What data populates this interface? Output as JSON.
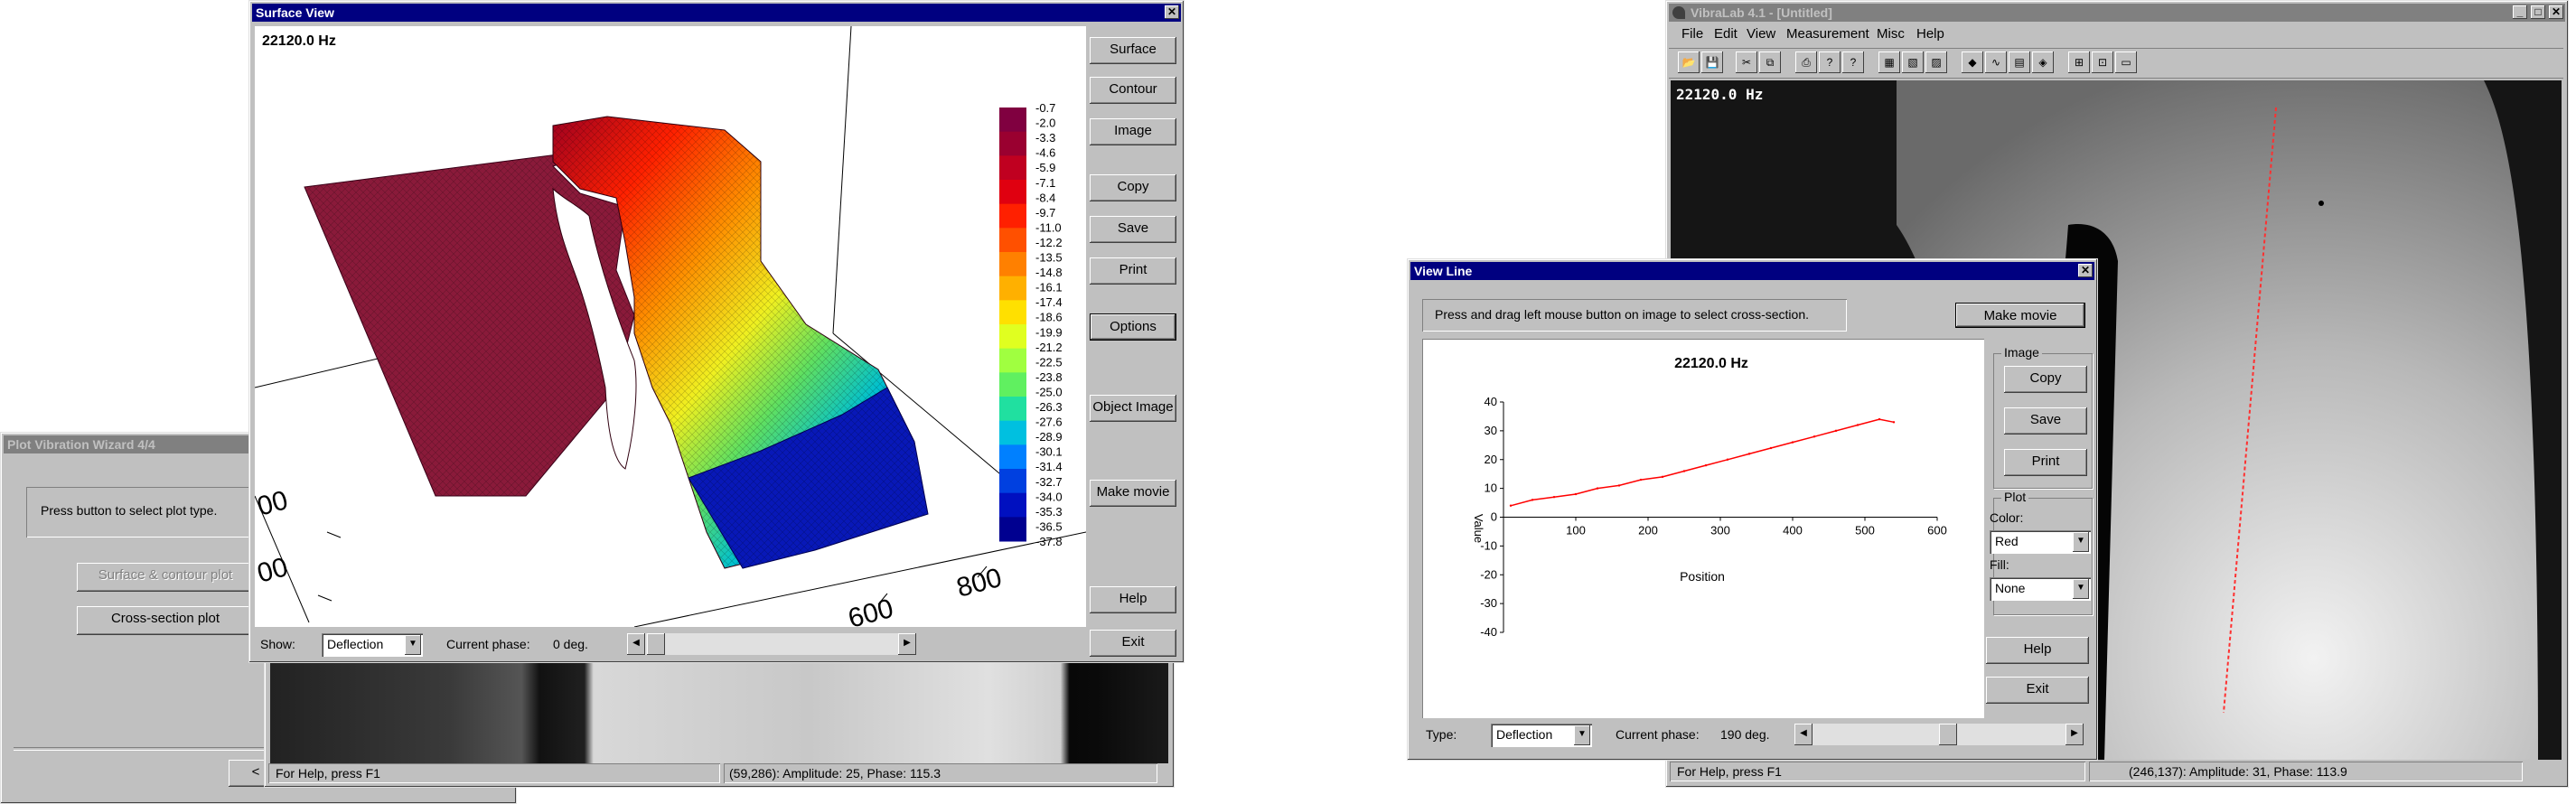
{
  "wizard": {
    "title": "Plot Vibration Wizard 4/4",
    "instruction": "Press button to select plot type.",
    "surface_btn": "Surface & contour plot",
    "cross_btn": "Cross-section plot",
    "back_btn": "<"
  },
  "mid_app": {
    "status_help": "For Help, press F1",
    "status_coords": "(59,286): Amplitude: 25, Phase: 115.3"
  },
  "surface": {
    "title": "Surface View",
    "freq": "22120.0 Hz",
    "buttons": [
      "Surface",
      "Contour",
      "Image",
      "Copy",
      "Save",
      "Print",
      "Options",
      "Object Image",
      "Make movie",
      "Help",
      "Exit"
    ],
    "show_label": "Show:",
    "show_value": "Deflection",
    "phase_label": "Current phase:",
    "phase_value": "0 deg.",
    "axis_labels": [
      "00",
      "00",
      "600",
      "800"
    ],
    "colorbar": [
      "-0.7",
      "-2.0",
      "-3.3",
      "-4.6",
      "-5.9",
      "-7.1",
      "-8.4",
      "-9.7",
      "-11.0",
      "-12.2",
      "-13.5",
      "-14.8",
      "-16.1",
      "-17.4",
      "-18.6",
      "-19.9",
      "-21.2",
      "-22.5",
      "-23.8",
      "-25.0",
      "-26.3",
      "-27.6",
      "-28.9",
      "-30.1",
      "-31.4",
      "-32.7",
      "-34.0",
      "-35.3",
      "-36.5",
      "-37.8"
    ],
    "colorbar_colors": [
      "#800040",
      "#9a0030",
      "#c00020",
      "#e00010",
      "#ff2000",
      "#ff5000",
      "#ff8000",
      "#ffb000",
      "#ffe000",
      "#e0ff20",
      "#a0ff40",
      "#60f060",
      "#20e0a0",
      "#00c0e0",
      "#0080ff",
      "#0040e0",
      "#0010c0",
      "#000090"
    ]
  },
  "vibralab": {
    "title": "VibraLab 4.1 - [Untitled]",
    "menu": [
      "File",
      "Edit",
      "View",
      "Measurement",
      "Misc",
      "Help"
    ],
    "freq_overlay": "22120.0 Hz",
    "status_help": "For Help, press F1",
    "status_coords": "(246,137): Amplitude: 31, Phase: 113.9"
  },
  "viewline": {
    "title": "View Line",
    "instruction": "Press and drag left mouse button on image to select cross-section.",
    "make_movie": "Make movie",
    "image_group": "Image",
    "copy": "Copy",
    "save": "Save",
    "print": "Print",
    "plot_group": "Plot",
    "color_label": "Color:",
    "color_value": "Red",
    "fill_label": "Fill:",
    "fill_value": "None",
    "help": "Help",
    "exit": "Exit",
    "type_label": "Type:",
    "type_value": "Deflection",
    "phase_label": "Current phase:",
    "phase_value": "190 deg."
  },
  "chart_data": {
    "type": "line",
    "title": "22120.0 Hz",
    "xlabel": "Position",
    "ylabel": "Value",
    "xlim": [
      0,
      600
    ],
    "ylim": [
      -40,
      40
    ],
    "xticks": [
      100,
      200,
      300,
      400,
      500,
      600
    ],
    "yticks": [
      40,
      30,
      20,
      10,
      0,
      -10,
      -20,
      -30,
      -40
    ],
    "series": [
      {
        "color": "#ff0000",
        "x": [
          10,
          40,
          70,
          100,
          130,
          160,
          190,
          220,
          250,
          280,
          310,
          340,
          370,
          400,
          430,
          460,
          490,
          520,
          540
        ],
        "y": [
          4,
          6,
          7,
          8,
          10,
          11,
          13,
          14,
          16,
          18,
          20,
          22,
          24,
          26,
          28,
          30,
          32,
          34,
          33
        ]
      }
    ]
  }
}
